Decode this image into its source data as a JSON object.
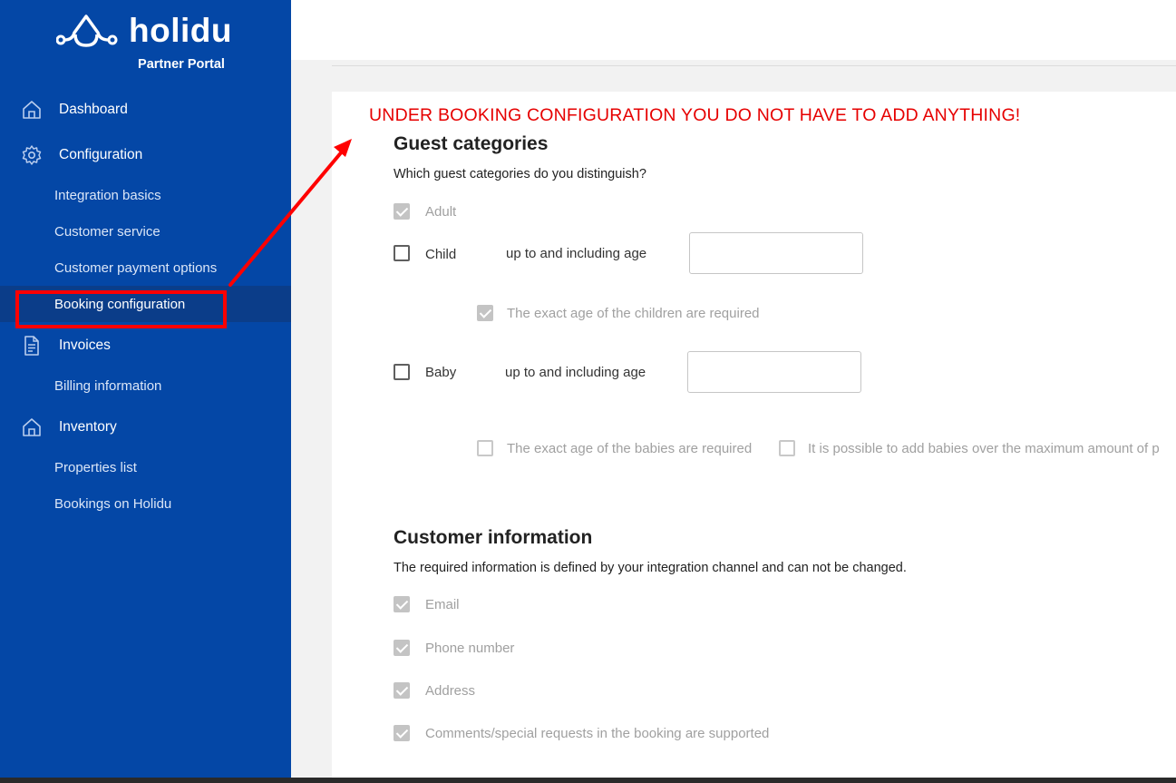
{
  "brand": {
    "name": "holidu",
    "subtitle": "Partner Portal"
  },
  "sidebar": {
    "dashboard": "Dashboard",
    "configuration": "Configuration",
    "config_items": [
      "Integration basics",
      "Customer service",
      "Customer payment options",
      "Booking configuration"
    ],
    "invoices": "Invoices",
    "invoice_items": [
      "Billing information"
    ],
    "inventory": "Inventory",
    "inventory_items": [
      "Properties list",
      "Bookings on Holidu"
    ],
    "active_item": "Booking configuration"
  },
  "annotation": {
    "text": "UNDER BOOKING CONFIGURATION YOU DO NOT HAVE TO ADD ANYTHING!",
    "color": "#e60000"
  },
  "guest_categories": {
    "title": "Guest categories",
    "description": "Which guest categories do you distinguish?",
    "adult": {
      "label": "Adult",
      "checked": true
    },
    "child": {
      "label": "Child",
      "checked": false,
      "age_label": "up to and including age",
      "age_value": ""
    },
    "child_exact_age": {
      "label": "The exact age of the children are required",
      "checked": true
    },
    "baby": {
      "label": "Baby",
      "checked": false,
      "age_label": "up to and including age",
      "age_value": ""
    },
    "baby_exact_age": {
      "label": "The exact age of the babies are required",
      "checked": false
    },
    "baby_over_max": {
      "label": "It is possible to add babies over the maximum amount of p",
      "checked": false
    }
  },
  "customer_information": {
    "title": "Customer information",
    "description": "The required information is defined by your integration channel and can not be changed.",
    "items": [
      "Email",
      "Phone number",
      "Address",
      "Comments/special requests in the booking are supported"
    ]
  },
  "colors": {
    "sidebar": "#0447a6",
    "sidebar_active": "#0b3d89",
    "highlight": "#ff0000"
  }
}
